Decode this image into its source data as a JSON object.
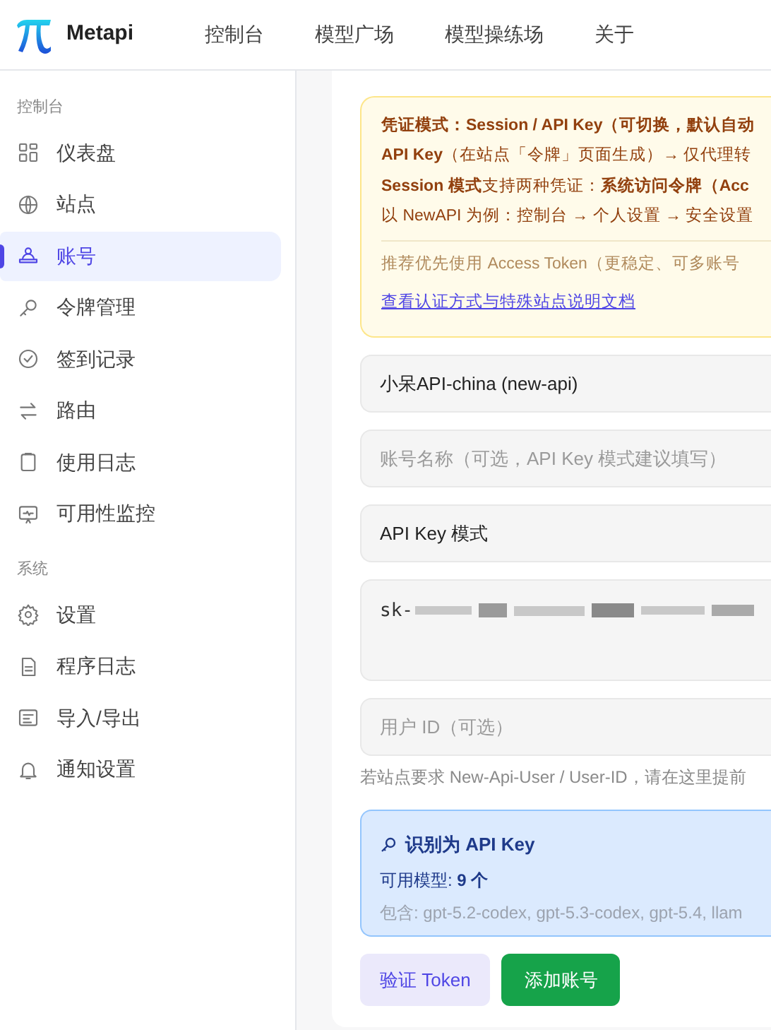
{
  "app": {
    "name": "Metapi"
  },
  "nav": [
    {
      "label": "控制台"
    },
    {
      "label": "模型广场"
    },
    {
      "label": "模型操练场"
    },
    {
      "label": "关于"
    }
  ],
  "sidebar": {
    "sections": [
      {
        "title": "控制台",
        "items": [
          {
            "label": "仪表盘",
            "selected": false
          },
          {
            "label": "站点",
            "selected": false
          },
          {
            "label": "账号",
            "selected": true
          },
          {
            "label": "令牌管理",
            "selected": false
          },
          {
            "label": "签到记录",
            "selected": false
          },
          {
            "label": "路由",
            "selected": false
          },
          {
            "label": "使用日志",
            "selected": false
          },
          {
            "label": "可用性监控",
            "selected": false
          }
        ]
      },
      {
        "title": "系统",
        "items": [
          {
            "label": "设置",
            "selected": false
          },
          {
            "label": "程序日志",
            "selected": false
          },
          {
            "label": "导入/导出",
            "selected": false
          },
          {
            "label": "通知设置",
            "selected": false
          }
        ]
      }
    ]
  },
  "notice": {
    "lines": [
      "凭证模式：Session / API Key（可切换，默认自动",
      "**API Key**（在站点「令牌」页面生成）→ 仅代理转",
      "**Session 模式**支持两种凭证：**系统访问令牌（Acc**",
      "以 NewAPI 为例：控制台 → 个人设置 → 安全设置"
    ],
    "tip": "推荐优先使用 Access Token（更稳定、可多账号",
    "link": "查看认证方式与特殊站点说明文档"
  },
  "form": {
    "fields": [
      {
        "kind": "select",
        "value": "小呆API-china (new-api)"
      },
      {
        "kind": "input",
        "placeholder": "账号名称（可选，API Key 模式建议填写）"
      },
      {
        "kind": "select",
        "value": "API Key 模式"
      },
      {
        "kind": "secret",
        "value": "sk-"
      },
      {
        "kind": "input",
        "placeholder": "用户 ID（可选）"
      }
    ],
    "hint": "若站点要求 New-Api-User / User-ID，请在这里提前"
  },
  "detection": {
    "title": "识别为 API Key",
    "models": "可用模型: **9 个**",
    "includes": "包含: gpt-5.2-codex, gpt-5.3-codex, gpt-5.4, llam"
  },
  "buttons": [
    {
      "label": "验证 Token",
      "kind": "secondary"
    },
    {
      "label": "添加账号",
      "kind": "primary"
    }
  ]
}
